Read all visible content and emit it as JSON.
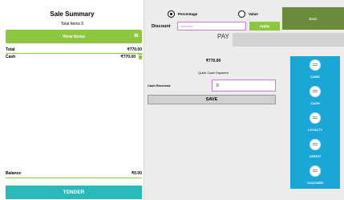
{
  "summary": {
    "title": "Sale Summary",
    "total_items": "Total Items 5",
    "view_items": "View Items",
    "chevron": "«",
    "total_label": "Total",
    "total_value": "₹770.00",
    "cash_label": "Cash",
    "cash_value": "₹770.00",
    "balance_label": "Balance",
    "balance_value": "₹0.00",
    "tender": "TENDER"
  },
  "discount": {
    "options": [
      "Percentage",
      "Value"
    ],
    "selected": "Percentage",
    "label": "Discount",
    "placeholder": "Discount",
    "apply": "Apply"
  },
  "back": "Back",
  "pay": {
    "label": "PAY",
    "amount": "₹770.00",
    "quick": "Quick Cash Payment",
    "cash_received_label": "Cash Received",
    "cash_received_value": "0",
    "save": "SAVE"
  },
  "methods": [
    "CARD",
    "CASH",
    "LOYALTY",
    "CREDIT",
    "VOUCHER"
  ],
  "colors": {
    "accent_green": "#8dc63f",
    "back_green": "#6c8a3c",
    "tender_teal": "#2ab8b8",
    "tile_blue": "#1aa7d8",
    "input_border": "#d27bd2"
  }
}
